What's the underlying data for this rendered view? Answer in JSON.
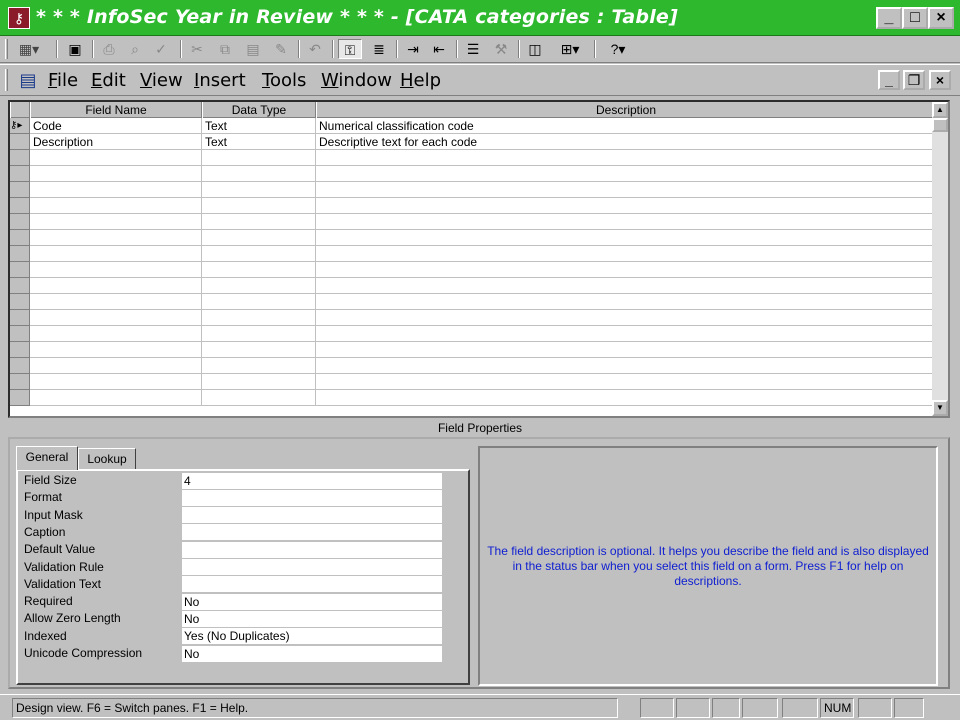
{
  "window": {
    "title": "* * * InfoSec Year in Review * * * - [CATA categories : Table]",
    "app_icon": "access-key-icon",
    "controls": {
      "minimize": "_",
      "maximize": "□",
      "close": "×"
    }
  },
  "toolbar": {
    "buttons": [
      "view-icon",
      "save-icon",
      "print-icon",
      "print-preview-icon",
      "spelling-icon",
      "cut-icon",
      "copy-icon",
      "paste-icon",
      "format-painter-icon",
      "undo-icon",
      "primary-key-icon",
      "indexes-icon",
      "insert-rows-icon",
      "delete-rows-icon",
      "properties-icon",
      "build-icon",
      "database-window-icon",
      "new-object-icon",
      "help-icon"
    ]
  },
  "menubar": {
    "items": [
      {
        "label": "File",
        "accel": "F"
      },
      {
        "label": "Edit",
        "accel": "E"
      },
      {
        "label": "View",
        "accel": "V"
      },
      {
        "label": "Insert",
        "accel": "I"
      },
      {
        "label": "Tools",
        "accel": "T"
      },
      {
        "label": "Window",
        "accel": "W"
      },
      {
        "label": "Help",
        "accel": "H"
      }
    ]
  },
  "grid": {
    "columns": [
      "Field Name",
      "Data Type",
      "Description"
    ],
    "rows": [
      {
        "field_name": "Code",
        "data_type": "Text",
        "description": "Numerical classification code",
        "selector": "key-current"
      },
      {
        "field_name": "Description",
        "data_type": "Text",
        "description": "Descriptive text for each code",
        "selector": ""
      }
    ],
    "empty_rows": 16
  },
  "field_properties": {
    "title": "Field Properties",
    "tabs": [
      "General",
      "Lookup"
    ],
    "active_tab": "General",
    "properties": [
      {
        "label": "Field Size",
        "value": "4"
      },
      {
        "label": "Format",
        "value": ""
      },
      {
        "label": "Input Mask",
        "value": ""
      },
      {
        "label": "Caption",
        "value": ""
      },
      {
        "label": "Default Value",
        "value": ""
      },
      {
        "label": "Validation Rule",
        "value": ""
      },
      {
        "label": "Validation Text",
        "value": ""
      },
      {
        "label": "Required",
        "value": "No"
      },
      {
        "label": "Allow Zero Length",
        "value": "No"
      },
      {
        "label": "Indexed",
        "value": "Yes (No Duplicates)"
      },
      {
        "label": "Unicode Compression",
        "value": "No"
      }
    ],
    "help_text": "The field description is optional.  It helps you describe the field and is also displayed in the status bar when you select this field on a form.  Press F1 for help on descriptions."
  },
  "statusbar": {
    "text": "Design view.  F6 = Switch panes.  F1 = Help.",
    "num": "NUM"
  },
  "colors": {
    "titlebar": "#2eb82e",
    "help_text": "#1020d0"
  }
}
